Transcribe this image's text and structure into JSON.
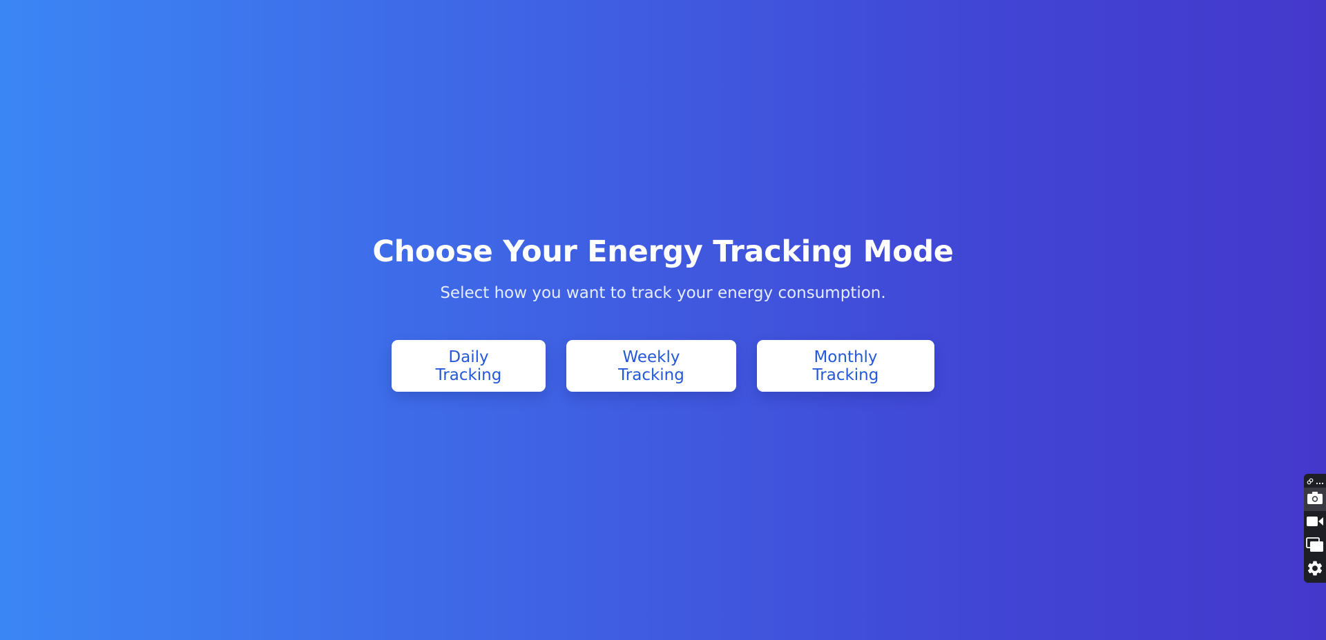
{
  "page": {
    "title": "Choose Your Energy Tracking Mode",
    "subtitle": "Select how you want to track your energy consumption."
  },
  "modes": [
    {
      "label": "Daily Tracking"
    },
    {
      "label": "Weekly Tracking"
    },
    {
      "label": "Monthly Tracking"
    }
  ],
  "toolbar": {
    "icons": [
      "link-icon",
      "more-icon",
      "camera-icon",
      "video-icon",
      "screens-icon",
      "gear-icon"
    ]
  },
  "colors": {
    "gradient_start": "#3b86f5",
    "gradient_end": "#4438cb",
    "button_text": "#2458d8",
    "button_bg": "#ffffff"
  }
}
